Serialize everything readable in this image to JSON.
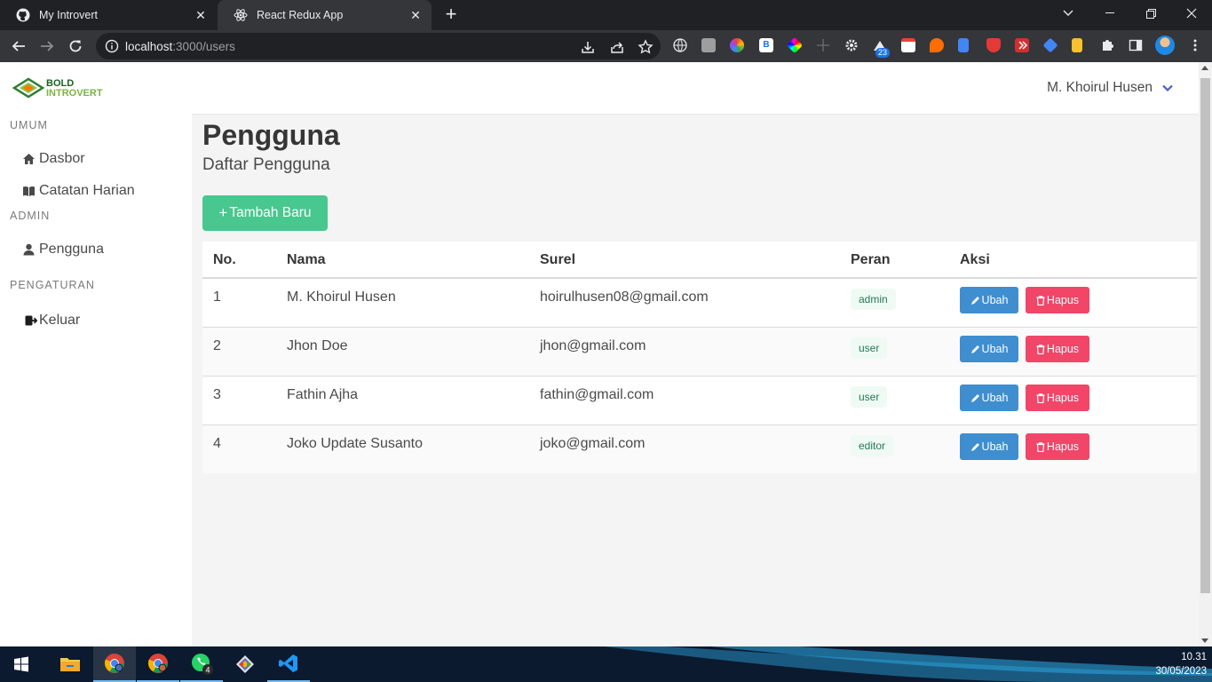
{
  "browser": {
    "tabs": [
      {
        "title": "My Introvert",
        "active": false
      },
      {
        "title": "React Redux App",
        "active": true
      }
    ],
    "address": {
      "host": "localhost",
      "rest": ":3000/users"
    },
    "extension_badge": "23"
  },
  "app": {
    "logo_text": [
      "BOLD",
      "INTROVERT"
    ],
    "user_name": "M. Khoirul Husen"
  },
  "sidebar": {
    "sections": [
      {
        "label": "UMUM",
        "items": [
          {
            "label": "Dasbor",
            "icon": "home-icon"
          },
          {
            "label": "Catatan Harian",
            "icon": "book-icon"
          }
        ]
      },
      {
        "label": "ADMIN",
        "items": [
          {
            "label": "Pengguna",
            "icon": "user-icon"
          }
        ]
      },
      {
        "label": "PENGATURAN",
        "items": [
          {
            "label": "Keluar",
            "icon": "sign-out-icon"
          }
        ]
      }
    ]
  },
  "page": {
    "title": "Pengguna",
    "subtitle": "Daftar Pengguna",
    "add_button": "Tambah Baru"
  },
  "table": {
    "headers": [
      "No.",
      "Nama",
      "Surel",
      "Peran",
      "Aksi"
    ],
    "rows": [
      {
        "no": "1",
        "name": "M. Khoirul Husen",
        "email": "hoirulhusen08@gmail.com",
        "role": "admin"
      },
      {
        "no": "2",
        "name": "Jhon Doe",
        "email": "jhon@gmail.com",
        "role": "user"
      },
      {
        "no": "3",
        "name": "Fathin Ajha",
        "email": "fathin@gmail.com",
        "role": "user"
      },
      {
        "no": "4",
        "name": "Joko Update Susanto",
        "email": "joko@gmail.com",
        "role": "editor"
      }
    ],
    "edit_label": "Ubah",
    "delete_label": "Hapus"
  },
  "taskbar": {
    "whatsapp_badge": "4",
    "time": "10.31",
    "date": "30/05/2023"
  },
  "colors": {
    "primary_green": "#48c78e",
    "edit_blue": "#3e8ed0",
    "delete_red": "#f14668"
  }
}
